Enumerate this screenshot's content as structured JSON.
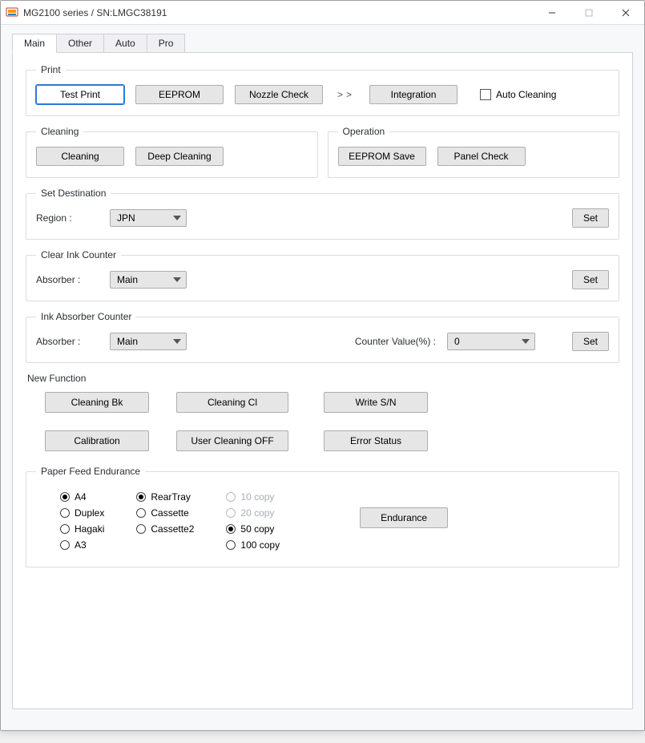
{
  "window": {
    "title": "MG2100 series / SN:LMGC38191"
  },
  "tabs": [
    "Main",
    "Other",
    "Auto",
    "Pro"
  ],
  "active_tab_index": 0,
  "print": {
    "legend": "Print",
    "test_print": "Test Print",
    "eeprom": "EEPROM",
    "nozzle": "Nozzle Check",
    "more": ">>",
    "integration": "Integration",
    "auto_cleaning_label": "Auto Cleaning",
    "auto_cleaning_checked": false
  },
  "cleaning": {
    "legend": "Cleaning",
    "cleaning": "Cleaning",
    "deep": "Deep Cleaning"
  },
  "operation": {
    "legend": "Operation",
    "eeprom_save": "EEPROM Save",
    "panel_check": "Panel Check"
  },
  "destination": {
    "legend": "Set Destination",
    "region_label": "Region :",
    "region_value": "JPN",
    "set": "Set"
  },
  "clear_ink": {
    "legend": "Clear Ink Counter",
    "absorber_label": "Absorber :",
    "absorber_value": "Main",
    "set": "Set"
  },
  "ink_abs": {
    "legend": "Ink Absorber Counter",
    "absorber_label": "Absorber :",
    "absorber_value": "Main",
    "counter_label": "Counter Value(%) :",
    "counter_value": "0",
    "set": "Set"
  },
  "new_function": {
    "heading": "New Function",
    "cleaning_bk": "Cleaning Bk",
    "cleaning_cl": "Cleaning Cl",
    "write_sn": "Write S/N",
    "calibration": "Calibration",
    "user_cleaning_off": "User Cleaning OFF",
    "error_status": "Error Status"
  },
  "pfe": {
    "legend": "Paper Feed Endurance",
    "paper_options": [
      {
        "label": "A4",
        "checked": true
      },
      {
        "label": "Duplex",
        "checked": false
      },
      {
        "label": "Hagaki",
        "checked": false
      },
      {
        "label": "A3",
        "checked": false
      }
    ],
    "tray_options": [
      {
        "label": "RearTray",
        "checked": true
      },
      {
        "label": "Cassette",
        "checked": false
      },
      {
        "label": "Cassette2",
        "checked": false
      }
    ],
    "copy_options": [
      {
        "label": "10 copy",
        "checked": false,
        "disabled": true
      },
      {
        "label": "20 copy",
        "checked": false,
        "disabled": true
      },
      {
        "label": "50 copy",
        "checked": true,
        "disabled": false
      },
      {
        "label": "100 copy",
        "checked": false,
        "disabled": false
      }
    ],
    "endurance": "Endurance"
  }
}
